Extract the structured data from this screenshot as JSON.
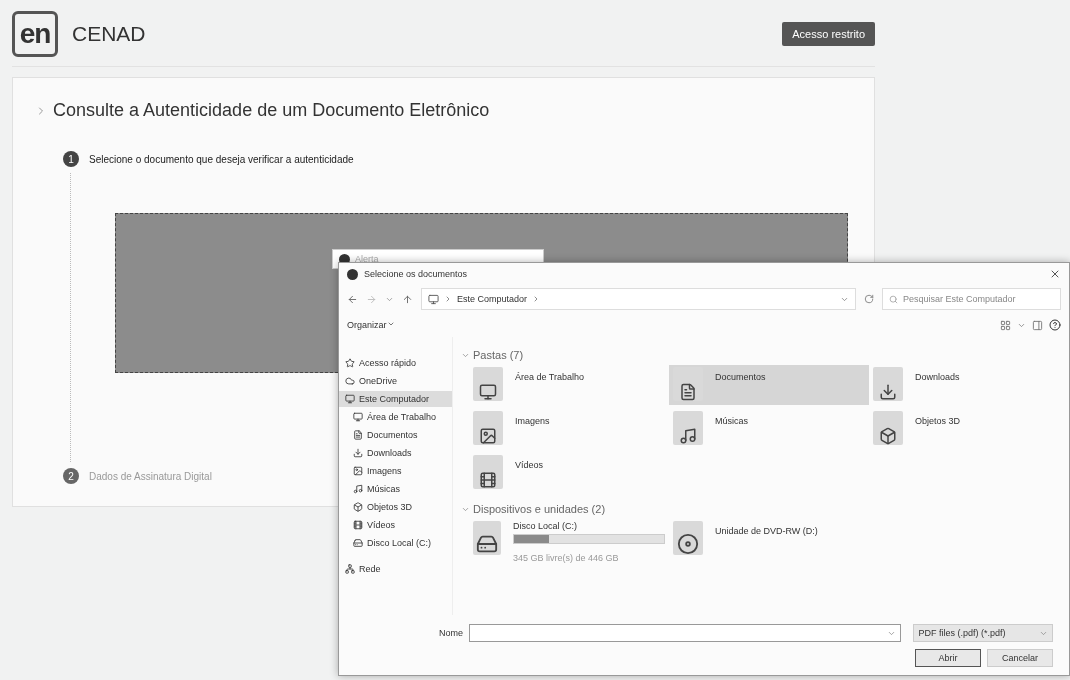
{
  "header": {
    "logo": "en",
    "brand": "CENAD",
    "button": "Acesso restrito"
  },
  "card": {
    "title": "Consulte a Autenticidade de um Documento Eletrônico",
    "steps": [
      {
        "number": "1",
        "label": "Selecione o documento que deseja verificar a autenticidade",
        "active": true
      },
      {
        "number": "2",
        "label": "Dados de Assinatura Digital",
        "active": false
      }
    ]
  },
  "alert": {
    "title": "Alerta"
  },
  "file_dialog": {
    "title": "Selecione os documentos",
    "path": "Este Computador",
    "search": {
      "placeholder": "Pesquisar Este Computador"
    },
    "organize": "Organizar",
    "nav": [
      {
        "label": "Acesso rápido",
        "selected": false
      },
      {
        "label": "OneDrive",
        "selected": false
      },
      {
        "label": "Este Computador",
        "selected": true,
        "children": [
          {
            "label": "Área de Trabalho",
            "selected": false
          },
          {
            "label": "Documentos",
            "selected": false
          },
          {
            "label": "Downloads",
            "selected": false
          },
          {
            "label": "Imagens",
            "selected": false
          },
          {
            "label": "Músicas",
            "selected": false
          },
          {
            "label": "Objetos 3D",
            "selected": false
          },
          {
            "label": "Vídeos",
            "selected": false
          },
          {
            "label": "Disco Local (C:)",
            "selected": false
          }
        ]
      },
      {
        "label": "Rede",
        "selected": false
      }
    ],
    "sections": [
      {
        "title": "Pastas (7)",
        "items": [
          {
            "label": "Área de Trabalho",
            "selected": false
          },
          {
            "label": "Documentos",
            "selected": true
          },
          {
            "label": "Downloads",
            "selected": false
          },
          {
            "label": "Imagens",
            "selected": false
          },
          {
            "label": "Músicas",
            "selected": false
          },
          {
            "label": "Objetos 3D",
            "selected": false
          },
          {
            "label": "Vídeos",
            "selected": false
          }
        ]
      },
      {
        "title": "Dispositivos e unidades (2)",
        "items": [
          {
            "kind": "disk",
            "label": "Disco Local (C:)",
            "level": 0.23,
            "detail": "345 GB livre(s) de 446 GB",
            "selected": false
          },
          {
            "kind": "dvd",
            "label": "Unidade de DVD-RW (D:)",
            "selected": false
          }
        ]
      }
    ],
    "name_label": "Nome",
    "file_type": "PDF files (.pdf) (*.pdf)",
    "buttons": [
      "Abrir",
      "Cancelar"
    ]
  }
}
